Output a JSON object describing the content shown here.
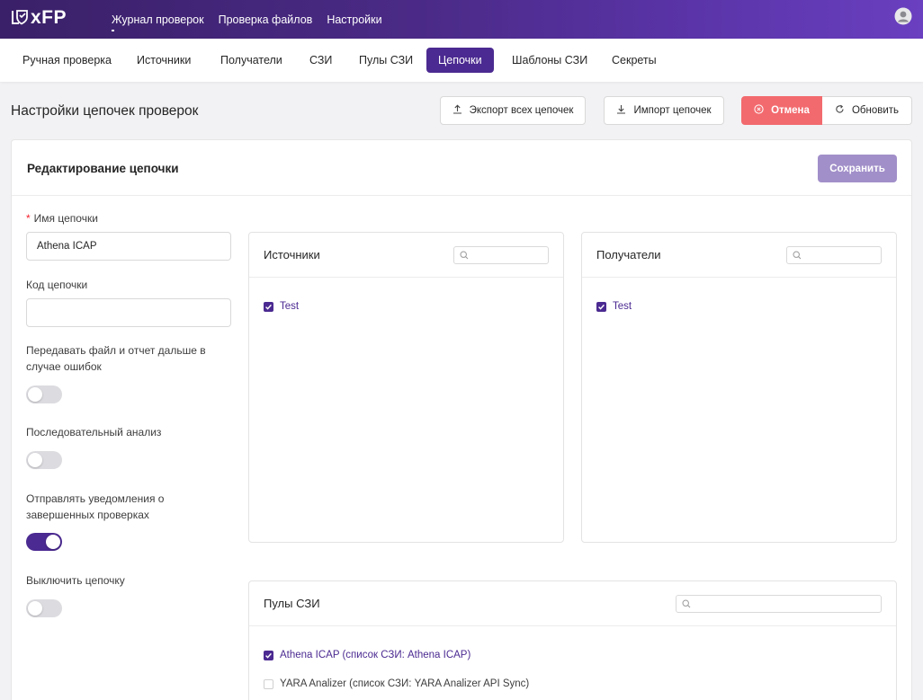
{
  "app": {
    "logo_text": "xFP",
    "nav": [
      "Журнал проверок",
      "Проверка файлов",
      "Настройки"
    ]
  },
  "tabs": [
    "Ручная проверка",
    "Источники",
    "Получатели",
    "СЗИ",
    "Пулы СЗИ",
    "Цепочки",
    "Шаблоны СЗИ",
    "Секреты"
  ],
  "active_tab": "Цепочки",
  "page": {
    "title": "Настройки цепочек проверок",
    "export_label": "Экспорт всех цепочек",
    "import_label": "Импорт цепочек",
    "cancel_label": "Отмена",
    "refresh_label": "Обновить"
  },
  "card": {
    "title": "Редактирование цепочки",
    "save_label": "Сохранить"
  },
  "form": {
    "name_label": "Имя цепочки",
    "name_value": "Athena ICAP",
    "code_label": "Код цепочки",
    "code_value": "",
    "pass_on_error_label": "Передавать файл и отчет дальше в случае ошибок",
    "pass_on_error": false,
    "sequential_label": "Последовательный анализ",
    "sequential": false,
    "notify_label": "Отправлять уведомления о завершенных проверках",
    "notify": true,
    "disable_label": "Выключить цепочку",
    "disable": false
  },
  "sources": {
    "title": "Источники",
    "items": [
      {
        "label": "Test",
        "checked": true
      }
    ]
  },
  "receivers": {
    "title": "Получатели",
    "items": [
      {
        "label": "Test",
        "checked": true
      }
    ]
  },
  "pools": {
    "title": "Пулы СЗИ",
    "items": [
      {
        "label": "Athena ICAP (список СЗИ: Athena ICAP)",
        "checked": true
      },
      {
        "label": "YARA Analizer (список СЗИ: YARA Analizer API Sync)",
        "checked": false
      }
    ]
  },
  "colors": {
    "accent": "#4b2a91",
    "cancel": "#f26a6e",
    "save_disabled": "#a18fc9"
  }
}
